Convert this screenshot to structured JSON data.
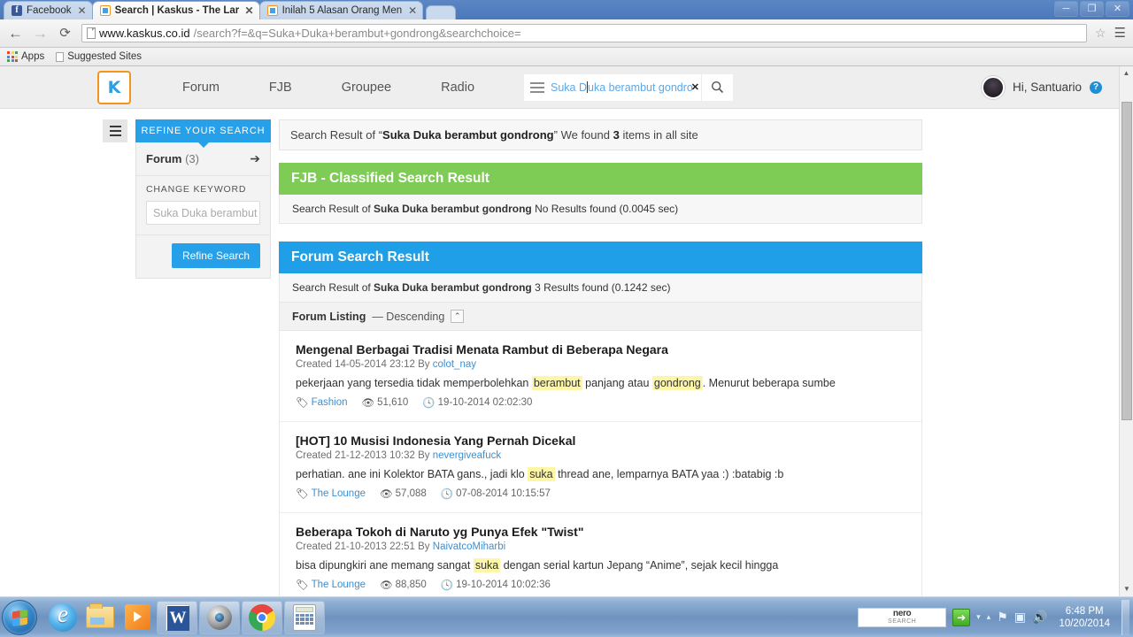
{
  "browser": {
    "tabs": [
      {
        "title": "Facebook",
        "favicon": "facebook-icon",
        "active": false
      },
      {
        "title": "Search | Kaskus - The Larg",
        "favicon": "kaskus-icon",
        "active": true
      },
      {
        "title": "Inilah 5 Alasan Orang Men",
        "favicon": "kaskus-icon",
        "active": false
      }
    ],
    "close_label": "✕",
    "window_controls": {
      "minimize": "─",
      "restore": "❐",
      "close": "✕"
    },
    "nav": {
      "back": "←",
      "forward": "→",
      "reload": "⟳",
      "menu": "☰",
      "star": "☆"
    },
    "url_domain": "www.kaskus.co.id",
    "url_rest": "/search?f=&q=Suka+Duka+berambut+gondrong&searchchoice=",
    "bookmarks": [
      {
        "label": "Apps",
        "icon": "apps-grid-icon"
      },
      {
        "label": "Suggested Sites",
        "icon": "page-icon"
      }
    ]
  },
  "site": {
    "logo_text": "K",
    "nav_links": [
      "Forum",
      "FJB",
      "Groupee",
      "Radio"
    ],
    "search": {
      "value_before_caret": "Suka D",
      "value_after_caret": "uka berambut gondro",
      "clear_label": "✕",
      "search_icon": "search-icon"
    },
    "user": {
      "greeting": "Hi, Santuario",
      "badge": "?"
    }
  },
  "sidebar": {
    "refine_header": "REFINE YOUR SEARCH",
    "forum_label": "Forum",
    "forum_count": "(3)",
    "arrow": "➔",
    "change_keyword_label": "CHANGE KEYWORD",
    "keyword_placeholder": "Suka Duka berambut",
    "refine_button": "Refine Search"
  },
  "main": {
    "summary_prefix": "Search Result of “",
    "summary_query": "Suka Duka berambut gondrong",
    "summary_mid": "” We found ",
    "summary_count": "3",
    "summary_suffix": " items in all site",
    "fjb": {
      "header": "FJB - Classified Search Result",
      "sub_prefix": "Search Result of ",
      "sub_query": "Suka Duka berambut gondrong",
      "sub_suffix": "  No Results found (0.0045 sec)"
    },
    "forum": {
      "header": "Forum Search Result",
      "sub_prefix": "Search Result of ",
      "sub_query": "Suka Duka berambut gondrong",
      "sub_suffix": " 3 Results found (0.1242 sec)",
      "listing_label": "Forum Listing",
      "listing_sep": "— Descending",
      "collapse_icon": "⌃"
    },
    "results": [
      {
        "title": "Mengenal Berbagai Tradisi Menata Rambut di Beberapa Negara",
        "created_label": "Created",
        "created_date": "14-05-2014 23:12",
        "by_label": "By",
        "author": "colot_nay",
        "snippet_pre": "pekerjaan yang tersedia tidak memperbolehkan ",
        "highlight1": "berambut",
        "snippet_mid": " panjang atau ",
        "highlight2": "gondrong",
        "snippet_post": ". Menurut beberapa sumbe",
        "tag": "Fashion",
        "views": "51,610",
        "timestamp": "19-10-2014 02:02:30"
      },
      {
        "title": "[HOT] 10 Musisi Indonesia Yang Pernah Dicekal",
        "created_label": "Created",
        "created_date": "21-12-2013 10:32",
        "by_label": "By",
        "author": "nevergiveafuck",
        "snippet_pre": "perhatian. ane ini Kolektor BATA gans., jadi klo ",
        "highlight1": "suka",
        "snippet_mid": " thread ane, lemparnya BATA yaa :) :batabig :b",
        "highlight2": "",
        "snippet_post": "",
        "tag": "The Lounge",
        "views": "57,088",
        "timestamp": "07-08-2014 10:15:57"
      },
      {
        "title": "Beberapa Tokoh di Naruto yg Punya Efek \"Twist\"",
        "created_label": "Created",
        "created_date": "21-10-2013 22:51",
        "by_label": "By",
        "author": "NaivatcoMiharbi",
        "snippet_pre": "bisa dipungkiri ane memang sangat ",
        "highlight1": "suka",
        "snippet_mid": " dengan serial kartun Jepang “Anime”, sejak kecil hingga",
        "highlight2": "",
        "snippet_post": "",
        "tag": "The Lounge",
        "views": "88,850",
        "timestamp": "19-10-2014 10:02:36"
      }
    ]
  },
  "taskbar": {
    "items": [
      {
        "name": "internet-explorer",
        "pinned": true
      },
      {
        "name": "windows-explorer",
        "pinned": true
      },
      {
        "name": "media-player",
        "pinned": true
      },
      {
        "name": "microsoft-word",
        "pinned": false
      },
      {
        "name": "webcam-app",
        "pinned": false
      },
      {
        "name": "google-chrome",
        "pinned": false
      },
      {
        "name": "calculator",
        "pinned": false
      }
    ],
    "tray": {
      "nero_line1": "nero",
      "nero_line2": "SEARCH",
      "green_arrow": "➜",
      "chevron_down": "▾",
      "chevron_up": "▴",
      "flag_icon": "⚑",
      "network_icon": "▣",
      "volume_icon": "🔊",
      "time": "6:48 PM",
      "date": "10/20/2014"
    }
  }
}
